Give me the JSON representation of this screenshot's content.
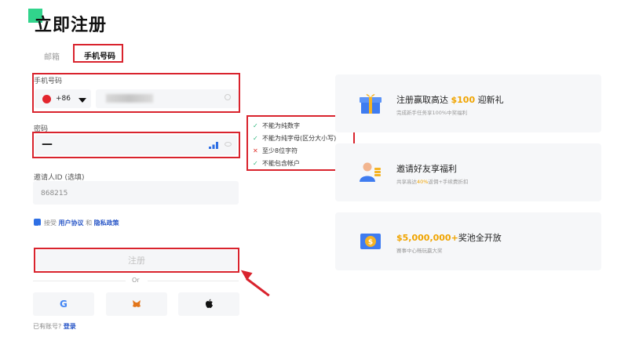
{
  "page": {
    "title": "立即注册"
  },
  "tabs": {
    "email": "邮箱",
    "phone": "手机号码"
  },
  "phone": {
    "label": "手机号码",
    "country_code": "+86"
  },
  "password": {
    "label": "密码",
    "value": "—"
  },
  "password_rules": [
    {
      "mark": "✓",
      "text": "不能为纯数字",
      "status": "pass"
    },
    {
      "mark": "✓",
      "text": "不能为纯字母(区分大小写)",
      "status": "pass"
    },
    {
      "mark": "✕",
      "text": "至少8位字符",
      "status": "fail"
    },
    {
      "mark": "✓",
      "text": "不能包含帐户",
      "status": "pass"
    }
  ],
  "invite": {
    "label": "邀请人ID (选填)",
    "value": "868215"
  },
  "agreement": {
    "prefix": "接受",
    "terms": "用户协议",
    "and": "和",
    "privacy": "隐私政策"
  },
  "signup_button": "注册",
  "divider": "Or",
  "social": {
    "google": "G",
    "metamask": "metamask-icon",
    "apple": "apple-icon"
  },
  "login": {
    "prefix": "已有账号?",
    "link": "登录"
  },
  "promos": [
    {
      "pre": "注册赢取高达 ",
      "highlight": "$100",
      "post": " 迎新礼",
      "sub_pre": "完成新手任务享100%中奖福利",
      "sub_hl": "",
      "sub_post": ""
    },
    {
      "pre": "邀请好友享福利",
      "highlight": "",
      "post": "",
      "sub_pre": "共享高达",
      "sub_hl": "40%",
      "sub_post": "返佣+手续费折扣"
    },
    {
      "pre": "",
      "highlight": "$5,000,000+",
      "post": "奖池全开放",
      "sub_pre": "赛事中心畅玩赢大奖",
      "sub_hl": "",
      "sub_post": ""
    }
  ],
  "colors": {
    "accent": "#31d48c",
    "annotation": "#d9232d",
    "link": "#2856c7",
    "highlight": "#f0a400",
    "pass": "#2eb67d",
    "fail": "#e0302a"
  }
}
